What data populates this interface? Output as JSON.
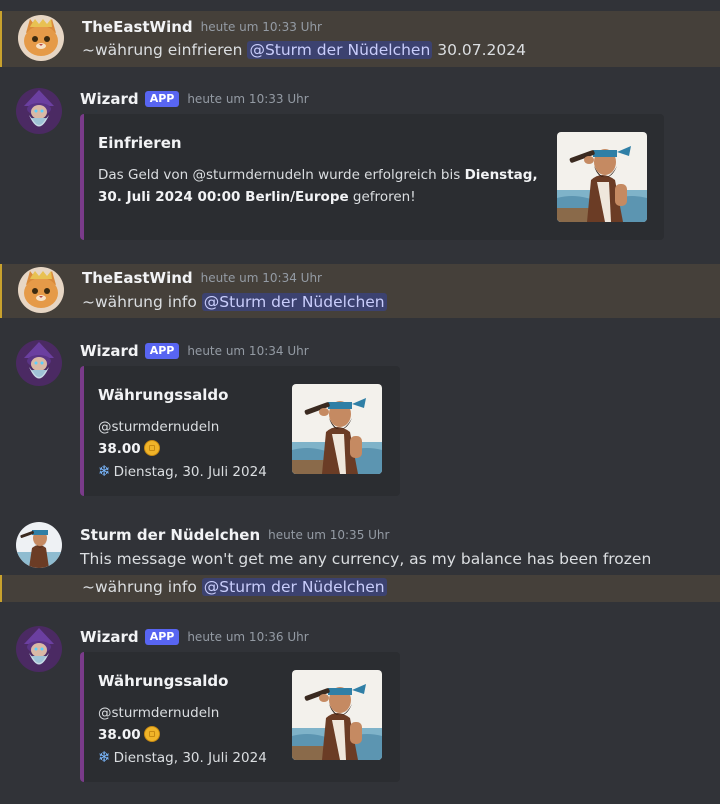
{
  "messages": {
    "m1": {
      "username": "TheEastWind",
      "timestamp": "heute um 10:33 Uhr",
      "content_prefix": "~währung einfrieren ",
      "mention": "@Sturm der Nüdelchen",
      "content_suffix": " 30.07.2024"
    },
    "m2": {
      "username": "Wizard",
      "badge": "APP",
      "timestamp": "heute um 10:33 Uhr",
      "embed": {
        "title": "Einfrieren",
        "desc_part1": "Das Geld von @sturmdernudeln wurde erfolgreich bis ",
        "desc_bold1": "Dienstag,",
        "desc_bold2": "30. Juli 2024 00:00 Berlin/Europe",
        "desc_part2": " gefroren!"
      }
    },
    "m3": {
      "username": "TheEastWind",
      "timestamp": "heute um 10:34 Uhr",
      "content_prefix": "~währung info ",
      "mention": "@Sturm der Nüdelchen"
    },
    "m4": {
      "username": "Wizard",
      "badge": "APP",
      "timestamp": "heute um 10:34 Uhr",
      "embed": {
        "title": "Währungssaldo",
        "user": "@sturmdernudeln",
        "balance": "38.00",
        "frozen_until": "Dienstag, 30. Juli 2024"
      }
    },
    "m5": {
      "username": "Sturm der Nüdelchen",
      "timestamp": "heute um 10:35 Uhr",
      "content": "This message won't get me any currency, as my balance has been frozen",
      "followup_prefix": "~währung info ",
      "followup_mention": "@Sturm der Nüdelchen"
    },
    "m6": {
      "username": "Wizard",
      "badge": "APP",
      "timestamp": "heute um 10:36 Uhr",
      "embed": {
        "title": "Währungssaldo",
        "user": "@sturmdernudeln",
        "balance": "38.00",
        "frozen_until": "Dienstag, 30. Juli 2024"
      }
    }
  },
  "icons": {
    "coin": "coin-icon",
    "snowflake": "snowflake-icon",
    "snowflake_glyph": "❄"
  },
  "colors": {
    "background": "#313338",
    "highlight": "#45403a",
    "highlight_border": "#c9a22d",
    "app_badge": "#5865f2",
    "embed_bg": "#2b2d31",
    "embed_border": "#7a3b8a",
    "mention_bg": "#3c4270",
    "mention_text": "#c9cdfb"
  }
}
